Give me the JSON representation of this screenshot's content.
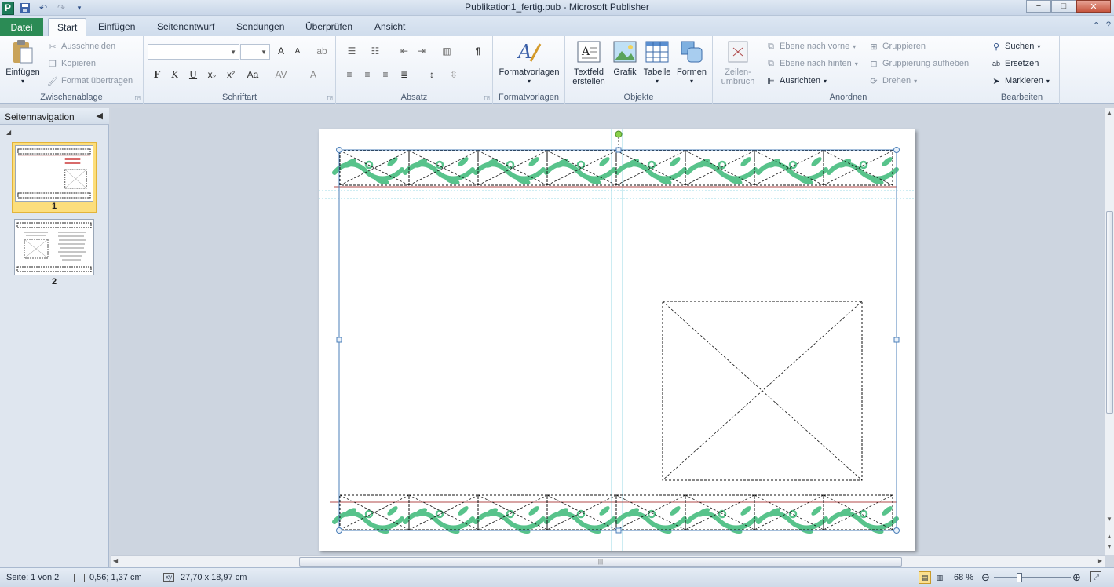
{
  "titlebar": {
    "title": "Publikation1_fertig.pub - Microsoft Publisher",
    "app_icon": "P",
    "qat": [
      "save-icon",
      "undo-icon",
      "redo-icon",
      "customize-icon"
    ],
    "win_min": "−",
    "win_max": "□",
    "win_close": "✕"
  },
  "tabs": {
    "file": "Datei",
    "items": [
      "Start",
      "Einfügen",
      "Seitenentwurf",
      "Sendungen",
      "Überprüfen",
      "Ansicht"
    ],
    "active": "Start"
  },
  "ribbon": {
    "clipboard": {
      "label": "Zwischenablage",
      "paste": "Einfügen",
      "cut": "Ausschneiden",
      "copy": "Kopieren",
      "format": "Format übertragen"
    },
    "font": {
      "label": "Schriftart",
      "bold": "F",
      "italic": "K",
      "underline": "U",
      "sub": "x₂",
      "sup": "x²",
      "case": "Aa",
      "spacing": "AV",
      "color": "A",
      "grow": "A",
      "shrink": "A"
    },
    "paragraph": {
      "label": "Absatz",
      "pilcrow": "¶"
    },
    "styles": {
      "label": "Formatvorlagen",
      "button": "Formatvorlagen"
    },
    "objects": {
      "label": "Objekte",
      "textbox1": "Textfeld",
      "textbox2": "erstellen",
      "picture": "Grafik",
      "table": "Tabelle",
      "shapes": "Formen"
    },
    "arrange": {
      "label": "Anordnen",
      "wrap1": "Zeilen-",
      "wrap2": "umbruch",
      "forward": "Ebene nach vorne",
      "backward": "Ebene nach hinten",
      "align": "Ausrichten",
      "group": "Gruppieren",
      "ungroup": "Gruppierung aufheben",
      "rotate": "Drehen"
    },
    "editing": {
      "label": "Bearbeiten",
      "find": "Suchen",
      "replace": "Ersetzen",
      "select": "Markieren"
    }
  },
  "nav": {
    "title": "Seitennavigation",
    "pages": [
      "1",
      "2"
    ],
    "selected": "1"
  },
  "status": {
    "page": "Seite: 1 von 2",
    "position": "0,56; 1,37 cm",
    "size": "27,70 x 18,97 cm",
    "zoom": "68 %",
    "zoom_level": 0.68
  },
  "colors": {
    "accent": "#2b8b55",
    "vine": "#58c38b",
    "guide": "#7fd0e0",
    "selection": "#4b7fb8"
  }
}
